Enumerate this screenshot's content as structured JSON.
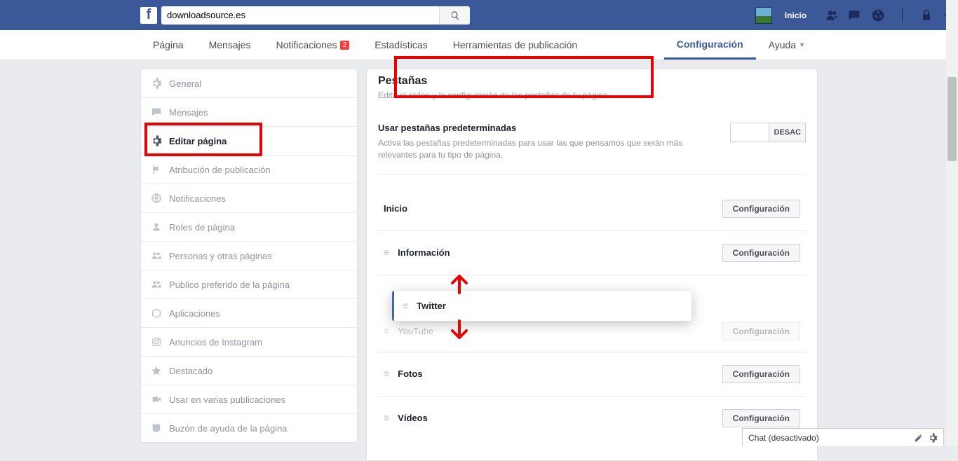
{
  "search": {
    "value": "downloadsource.es"
  },
  "top_link": {
    "inicio": "Inicio"
  },
  "tabs": {
    "pagina": "Página",
    "mensajes": "Mensajes",
    "notificaciones": "Notificaciones",
    "notificaciones_badge": "2",
    "estadisticas": "Estadísticas",
    "herramientas": "Herramientas de publicación",
    "configuracion": "Configuración",
    "ayuda": "Ayuda"
  },
  "sidebar": {
    "items": [
      "General",
      "Mensajes",
      "Editar página",
      "Atribución de publicación",
      "Notificaciones",
      "Roles de página",
      "Personas y otras páginas",
      "Público preferido de la página",
      "Aplicaciones",
      "Anuncios de Instagram",
      "Destacado",
      "Usar en varias publicaciones",
      "Buzón de ayuda de la página"
    ]
  },
  "main": {
    "header_title": "Pestañas",
    "header_desc": "Edita el orden y la configuración de las pestañas de tu página.",
    "pref_title": "Usar pestañas predeterminadas",
    "pref_desc": "Activa las pestañas predeterminadas para usar las que pensamos que serán más relevantes para tu tipo de página.",
    "toggle_state": "DESAC",
    "config_label": "Configuración",
    "rows": {
      "inicio": "Inicio",
      "informacion": "Información",
      "twitter": "Twitter",
      "youtube_partial": "YouTube",
      "fotos": "Fotos",
      "videos": "Vídeos"
    }
  },
  "chat": {
    "label": "Chat (desactivado)"
  }
}
